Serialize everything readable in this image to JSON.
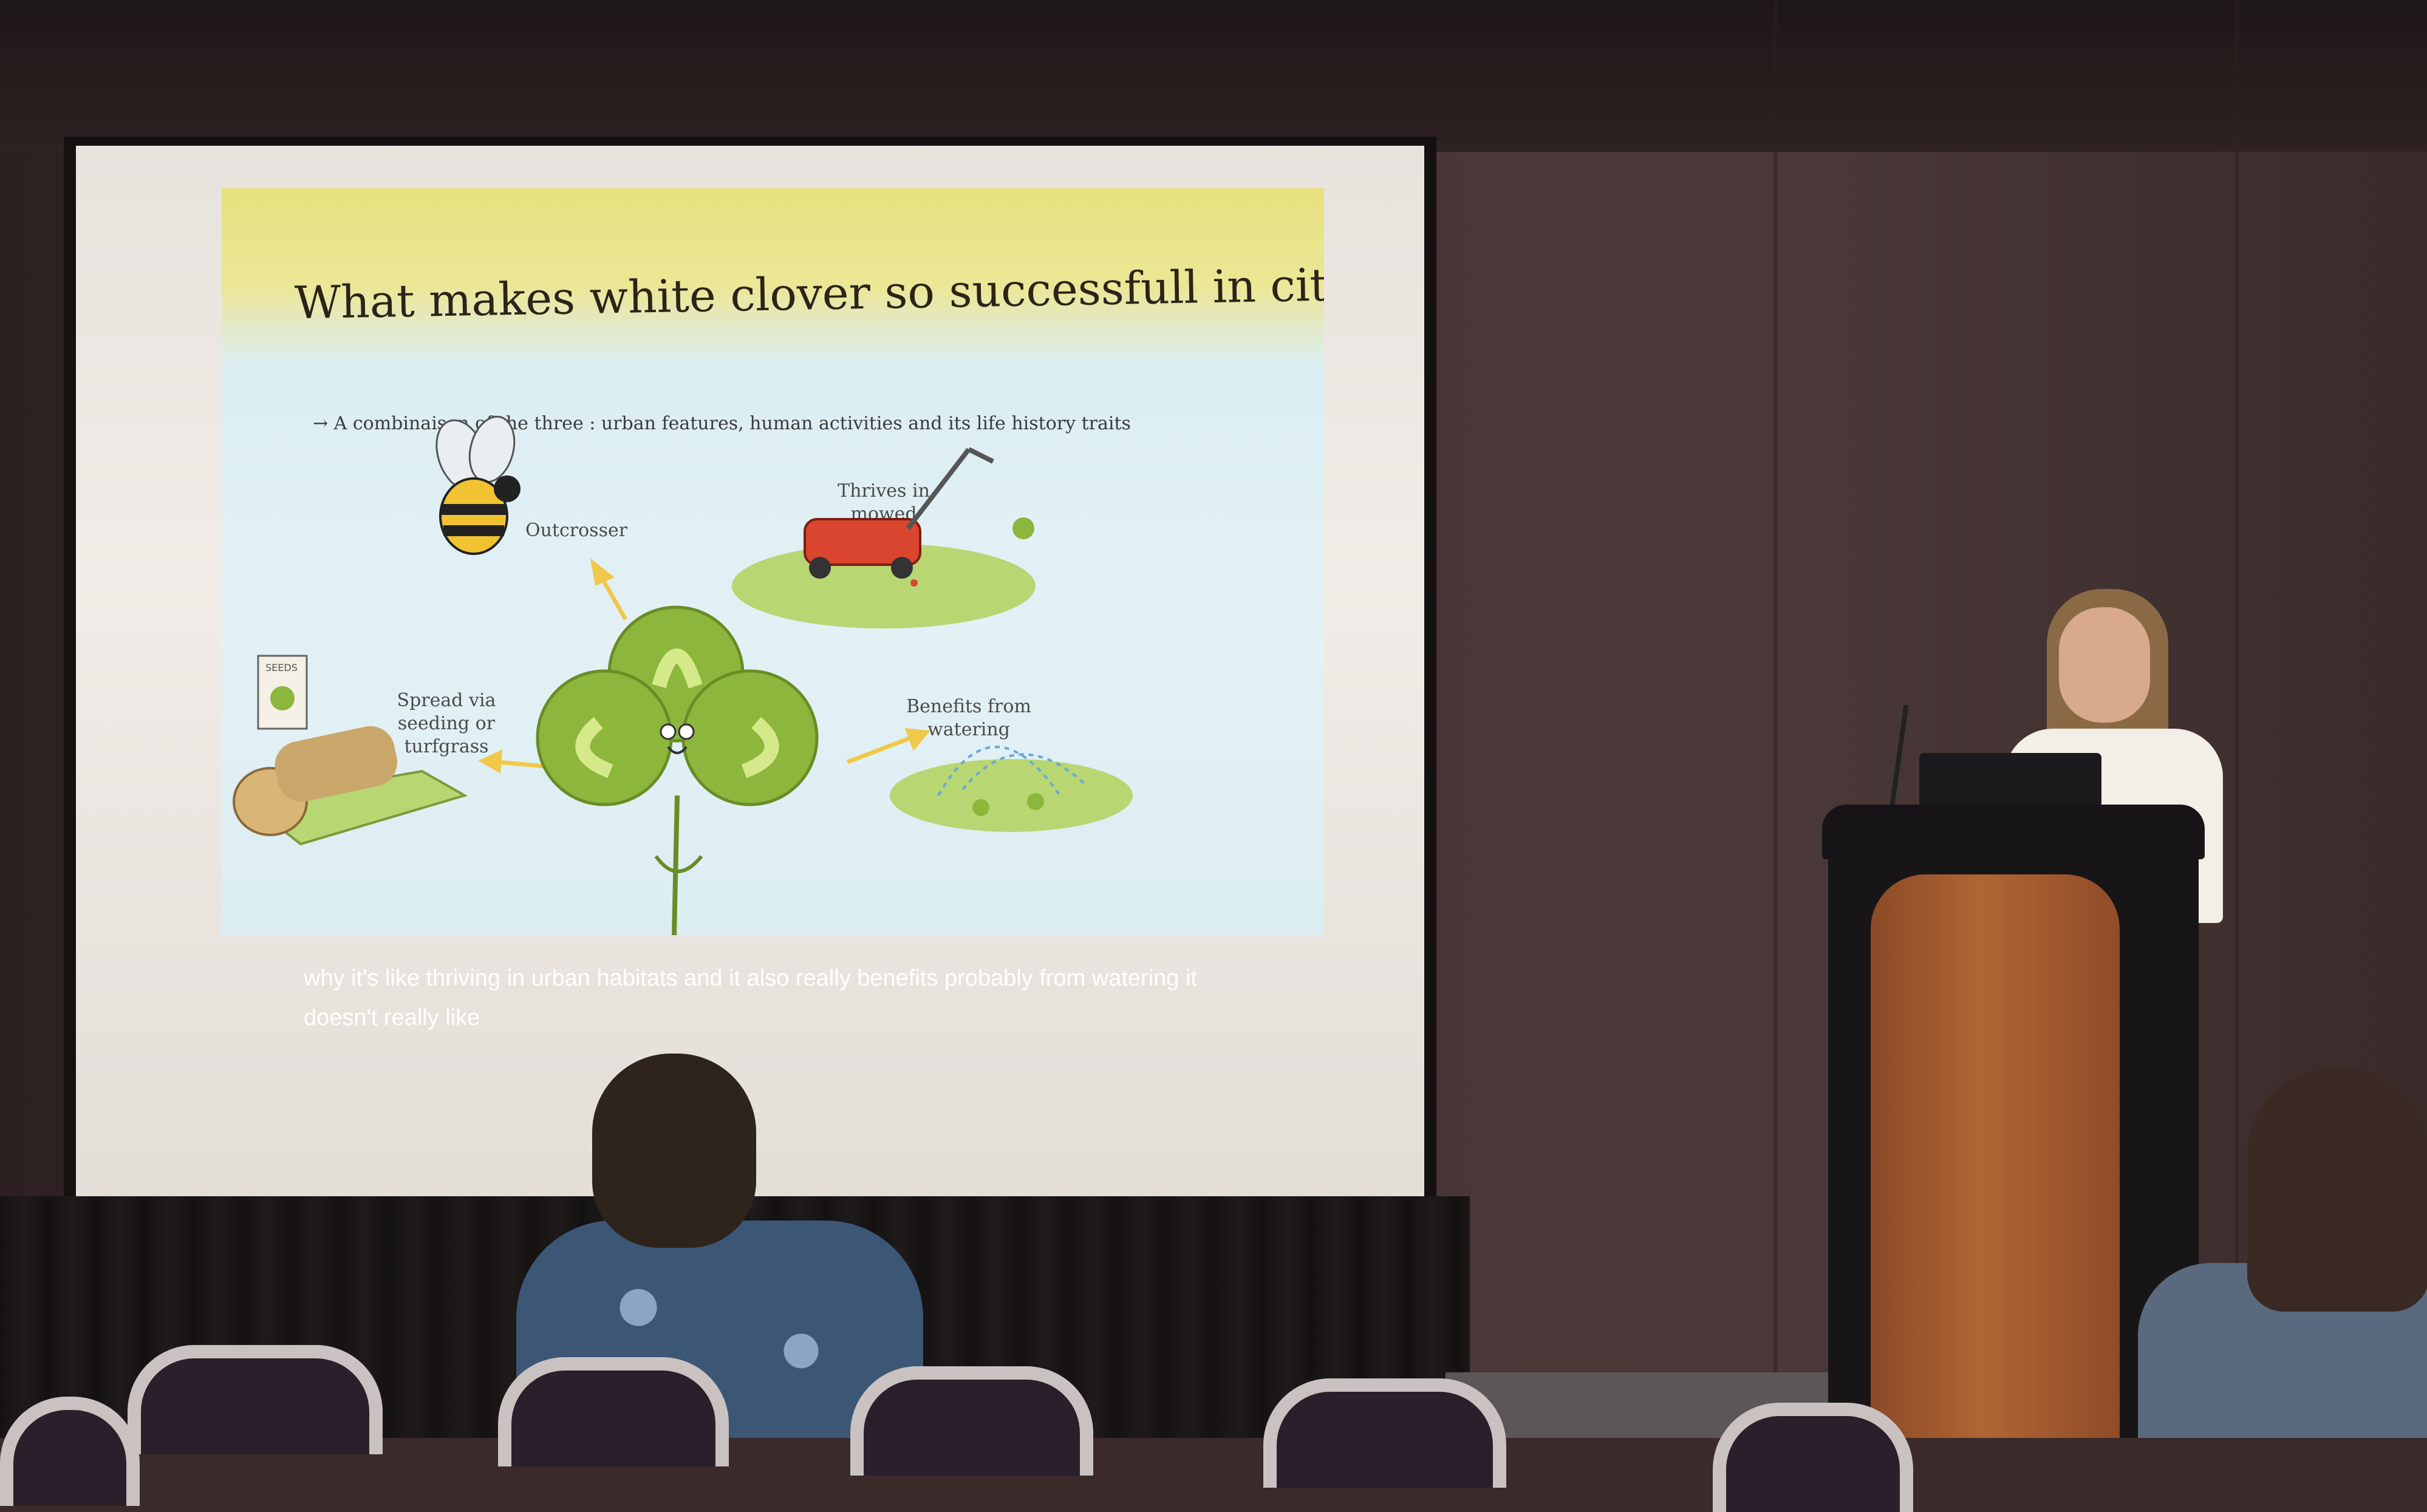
{
  "slide": {
    "title": "What makes white clover so successfull in cities ?",
    "subtitle": "→ A combinaison of the three : urban features, human activities and its life history traits",
    "labels": {
      "outcrosser": "Outcrosser",
      "mowed": "Thrives in mowed habitats",
      "spread": "Spread via seeding or turfgrass",
      "watering": "Benefits from watering"
    },
    "seed_bag_text": "SEEDS"
  },
  "captions": {
    "line1": "why it's like thriving in urban habitats and it also really benefits probably from watering it",
    "line2": "doesn't really like"
  },
  "colors": {
    "slide_banner": "#ece795",
    "slide_background": "#dcedf2",
    "clover_green": "#8cb63c",
    "mower_red": "#d9452e",
    "podium_wood": "#b06534"
  }
}
